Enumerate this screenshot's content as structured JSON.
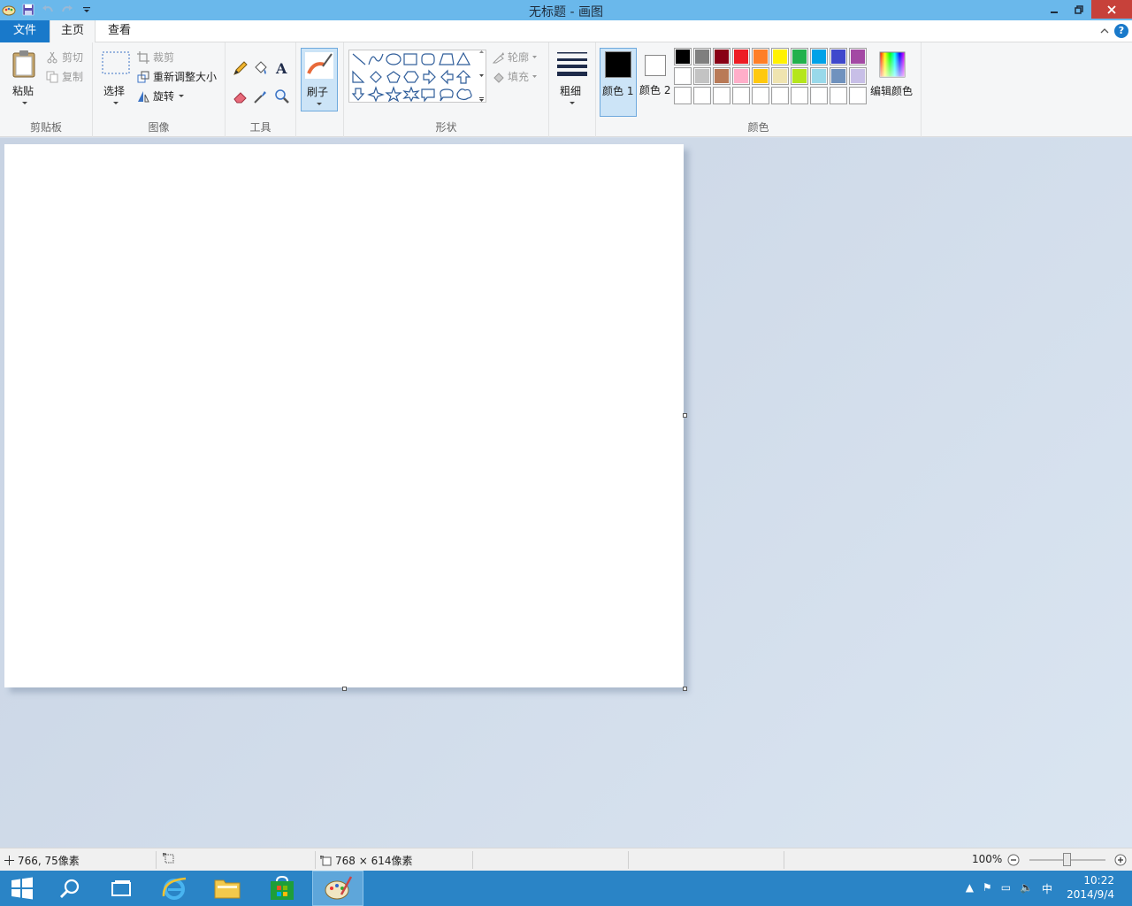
{
  "window": {
    "title": "无标题 - 画图"
  },
  "tabs": {
    "file": "文件",
    "home": "主页",
    "view": "查看"
  },
  "clipboard": {
    "paste": "粘贴",
    "cut": "剪切",
    "copy": "复制",
    "group": "剪贴板"
  },
  "image": {
    "select": "选择",
    "crop": "裁剪",
    "resize": "重新调整大小",
    "rotate": "旋转",
    "group": "图像"
  },
  "tools": {
    "group": "工具"
  },
  "brushes": {
    "label": "刷子"
  },
  "shapes": {
    "outline": "轮廓",
    "fill": "填充",
    "group": "形状"
  },
  "size": {
    "label": "粗细"
  },
  "colors": {
    "color1": "颜色 1",
    "color2": "颜色 2",
    "edit": "编辑颜色",
    "group": "颜色",
    "color1_value": "#000000",
    "color2_value": "#ffffff",
    "palette": [
      "#000000",
      "#7f7f7f",
      "#880015",
      "#ed1c24",
      "#ff7f27",
      "#fff200",
      "#22b14c",
      "#00a2e8",
      "#3f48cc",
      "#a349a4",
      "#ffffff",
      "#c3c3c3",
      "#b97a57",
      "#ffaec9",
      "#ffc90e",
      "#efe4b0",
      "#b5e61d",
      "#99d9ea",
      "#7092be",
      "#c8bfe7",
      "#ffffff",
      "#ffffff",
      "#ffffff",
      "#ffffff",
      "#ffffff",
      "#ffffff",
      "#ffffff",
      "#ffffff",
      "#ffffff",
      "#ffffff"
    ]
  },
  "status": {
    "cursor_pos": "766, 75像素",
    "image_size": "768 × 614像素",
    "zoom": "100%"
  },
  "taskbar": {
    "time": "10:22",
    "date": "2014/9/4",
    "ime": "中"
  }
}
